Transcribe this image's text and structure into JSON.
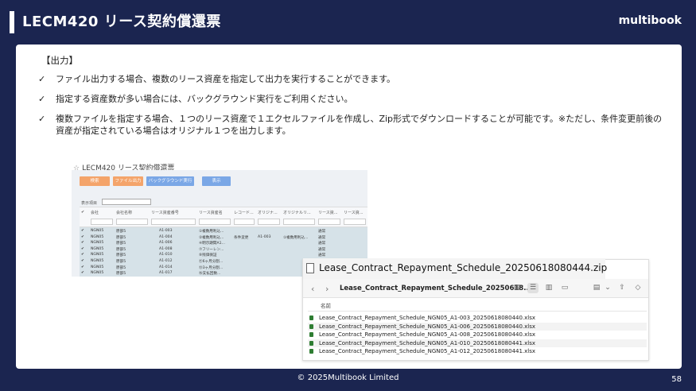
{
  "header": {
    "title": "LECM420 リース契約償還票",
    "brand": "multibook"
  },
  "content": {
    "section_label": "【出力】",
    "bullets": [
      "ファイル出力する場合、複数のリース資産を指定して出力を実行することができます。",
      "指定する資産数が多い場合には、バックグラウンド実行をご利用ください。",
      "複数ファイルを指定する場合、１つのリース資産で１エクセルファイルを作成し、Zip形式でダウンロードすることが可能です。※ただし、条件変更前後の資産が指定されている場合はオリジナル１つを出力します。"
    ]
  },
  "app_screenshot": {
    "title": "LECM420 リース契約償還票",
    "buttons": {
      "search": "検索",
      "file_output": "ファイル出力",
      "background": "バックグラウンド実行",
      "display": "表示"
    },
    "filter_label": "表示項目",
    "columns": [
      "会社",
      "会社名称",
      "リース資産番号",
      "リース資産名",
      "レコード...",
      "オリジナ...",
      "オリジナルリ...",
      "リース資...",
      "リース資..."
    ],
    "rows": [
      {
        "company": "NGN05",
        "name": "原部5",
        "asset": "A1-003",
        "asset_name": "①複数用利込...",
        "rec": "",
        "orig": "",
        "orig_name": "",
        "type": "通常"
      },
      {
        "company": "NGN05",
        "name": "原部5",
        "asset": "A1-004",
        "asset_name": "②複数用利込...",
        "rec": "条件変更",
        "orig": "A1-003",
        "orig_name": "①複数用利込...",
        "type": "通常"
      },
      {
        "company": "NGN05",
        "name": "原部5",
        "asset": "A1-006",
        "asset_name": "④明示期間A1...",
        "rec": "",
        "orig": "",
        "orig_name": "",
        "type": "通常"
      },
      {
        "company": "NGN05",
        "name": "原部5",
        "asset": "A1-008",
        "asset_name": "⑦フリーレン...",
        "rec": "",
        "orig": "",
        "orig_name": "",
        "type": "通常"
      },
      {
        "company": "NGN05",
        "name": "原部5",
        "asset": "A1-010",
        "asset_name": "⑨残価保証",
        "rec": "",
        "orig": "",
        "orig_name": "",
        "type": "通常"
      },
      {
        "company": "NGN05",
        "name": "原部5",
        "asset": "A1-012",
        "asset_name": "⑪6ヶ月分割...",
        "rec": "",
        "orig": "",
        "orig_name": "",
        "type": "通常"
      },
      {
        "company": "NGN05",
        "name": "原部5",
        "asset": "A1-014",
        "asset_name": "⑬3ヶ月分割...",
        "rec": "",
        "orig": "",
        "orig_name": "",
        "type": "通常"
      },
      {
        "company": "NGN05",
        "name": "原部5",
        "asset": "A1-017",
        "asset_name": "⑯支払回数...",
        "rec": "",
        "orig": "",
        "orig_name": "",
        "type": "通常"
      }
    ]
  },
  "finder": {
    "window_title": "Lease_Contract_Repayment_Schedule_20250618080444.zip",
    "breadcrumb": "Lease_Contract_Repayment_Schedule_20250618...",
    "column_name": "名前",
    "files": [
      "Lease_Contract_Repayment_Schedule_NGN05_A1-003_20250618080440.xlsx",
      "Lease_Contract_Repayment_Schedule_NGN05_A1-006_20250618080440.xlsx",
      "Lease_Contract_Repayment_Schedule_NGN05_A1-008_20250618080440.xlsx",
      "Lease_Contract_Repayment_Schedule_NGN05_A1-010_20250618080441.xlsx",
      "Lease_Contract_Repayment_Schedule_NGN05_A1-012_20250618080441.xlsx"
    ]
  },
  "footer": {
    "copyright": "© 2025Multibook Limited",
    "page": "58"
  },
  "colors": {
    "background": "#1b2550",
    "orange_button": "#f4a46a",
    "blue_button": "#7aa7e6",
    "row_highlight": "#d6e2e8",
    "excel_icon": "#2e7d32"
  }
}
